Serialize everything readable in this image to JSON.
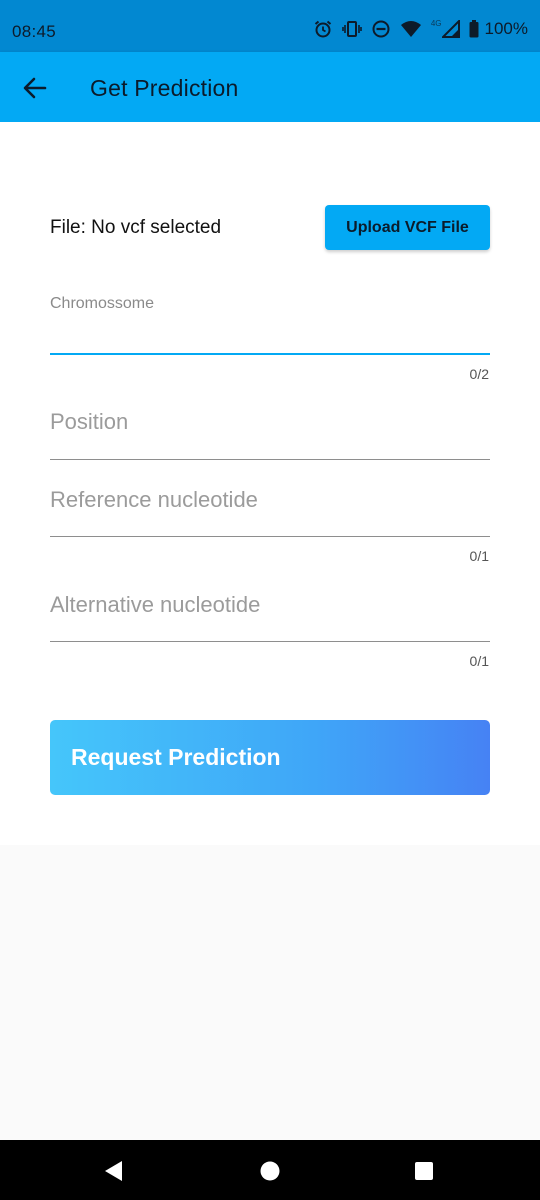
{
  "status_bar": {
    "time": "08:45",
    "network_tag": "4G",
    "battery_percent": "100%",
    "icons": [
      "alarm-icon",
      "vibrate-icon",
      "do-not-disturb-icon",
      "wifi-icon",
      "signal-icon",
      "battery-icon"
    ]
  },
  "app_bar": {
    "title": "Get Prediction",
    "back_icon": "arrow-left-icon"
  },
  "form": {
    "file_label": "File: No vcf selected",
    "upload_button": "Upload VCF File",
    "chromosome": {
      "label": "Chromossome",
      "value": "",
      "counter": "0/2"
    },
    "position": {
      "label": "Position",
      "value": ""
    },
    "reference": {
      "label": "Reference nucleotide",
      "value": "",
      "counter": "0/1"
    },
    "alternative": {
      "label": "Alternative nucleotide",
      "value": "",
      "counter": "0/1"
    },
    "request_button": "Request Prediction"
  },
  "nav_bar": {
    "icons": [
      "back-triangle-icon",
      "home-circle-icon",
      "recents-square-icon"
    ]
  },
  "colors": {
    "status_bar": "#0288d1",
    "app_bar": "#03a9f4",
    "accent": "#03a9f4",
    "gradient_start": "#45c6fa",
    "gradient_end": "#4682f4"
  }
}
